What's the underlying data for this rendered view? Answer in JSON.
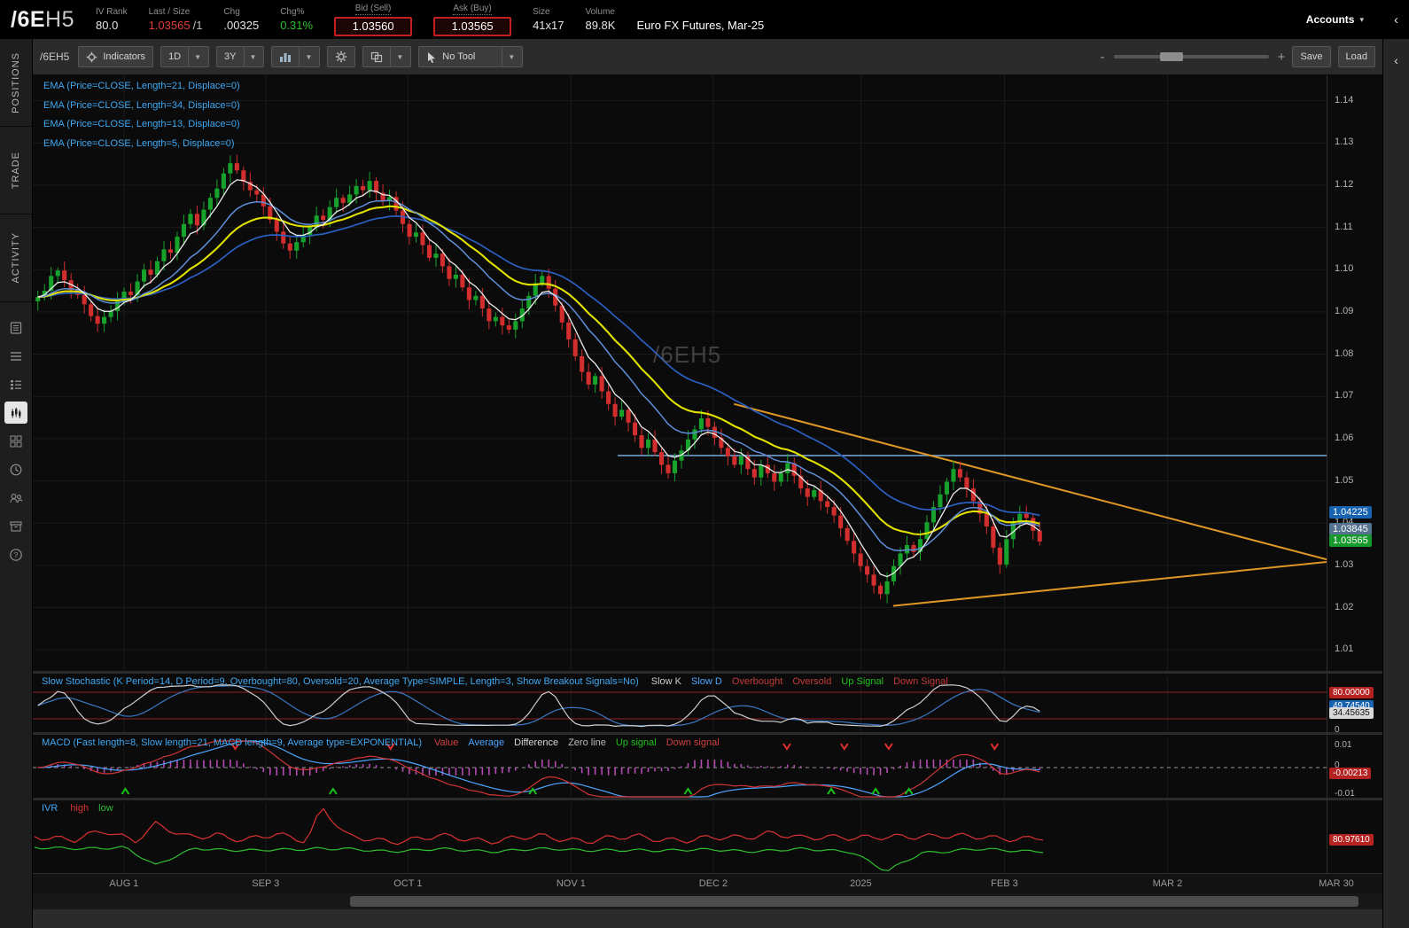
{
  "header": {
    "symbol_root": "/6E",
    "symbol_month": "H5",
    "ivrank_label": "IV Rank",
    "ivrank_value": "80.0",
    "last_label": "Last / Size",
    "last_value": "1.03565",
    "last_size": "/1",
    "chg_label": "Chg",
    "chg_value": ".00325",
    "chgpct_label": "Chg%",
    "chgpct_value": "0.31%",
    "bid_label": "Bid (Sell)",
    "bid_value": "1.03560",
    "ask_label": "Ask (Buy)",
    "ask_value": "1.03565",
    "size_label": "Size",
    "size_value": "41x17",
    "volume_label": "Volume",
    "volume_value": "89.8K",
    "description": "Euro FX Futures, Mar-25",
    "accounts_label": "Accounts",
    "collapse_icon": "‹"
  },
  "sidebar": {
    "tabs": [
      {
        "label": "POSITIONS"
      },
      {
        "label": "TRADE"
      },
      {
        "label": "ACTIVITY"
      }
    ]
  },
  "toolbar": {
    "symbol": "/6EH5",
    "indicators": "Indicators",
    "timeframe": "1D",
    "range": "3Y",
    "no_tool": "No Tool",
    "zoom_minus": "-",
    "zoom_plus": "+",
    "save": "Save",
    "load": "Load",
    "dropdown_arrow": "▼"
  },
  "chart": {
    "ema_labels": [
      "EMA (Price=CLOSE, Length=21, Displace=0)",
      "EMA (Price=CLOSE, Length=34, Displace=0)",
      "EMA (Price=CLOSE, Length=13, Displace=0)",
      "EMA (Price=CLOSE, Length=5, Displace=0)"
    ],
    "watermark": "/6EH5",
    "y_ticks": [
      "1.14",
      "1.13",
      "1.12",
      "1.11",
      "1.10",
      "1.09",
      "1.08",
      "1.07",
      "1.06",
      "1.05",
      "1.04",
      "1.03",
      "1.02",
      "1.01"
    ],
    "x_ticks": [
      {
        "label": "AUG 1",
        "frac": 0.0705
      },
      {
        "label": "SEP 3",
        "frac": 0.18
      },
      {
        "label": "OCT 1",
        "frac": 0.29
      },
      {
        "label": "NOV 1",
        "frac": 0.416
      },
      {
        "label": "DEC 2",
        "frac": 0.526
      },
      {
        "label": "2025",
        "frac": 0.64
      },
      {
        "label": "FEB 3",
        "frac": 0.751
      },
      {
        "label": "MAR 2",
        "frac": 0.877
      },
      {
        "label": "MAR 30",
        "frac": 1.0075
      }
    ],
    "price_bubbles": [
      {
        "text": "1.04225",
        "price": 1.04225,
        "bg": "#1863b0",
        "fg": "#ffffff"
      },
      {
        "text": "1.03845",
        "price": 1.03845,
        "bg": "#55738f",
        "fg": "#ffffff"
      },
      {
        "text": "1.03565",
        "price": 1.03565,
        "bg": "#159a2b",
        "fg": "#ffffff"
      }
    ]
  },
  "chart_data": {
    "type": "candlestick",
    "symbol": "/6EH5",
    "ylim": [
      1.005,
      1.146
    ],
    "up_color": "#17a32b",
    "down_color": "#d22e2e",
    "closes": [
      1.0935,
      1.095,
      1.0985,
      1.0998,
      1.0975,
      1.0952,
      1.094,
      1.0918,
      1.089,
      1.0872,
      1.0888,
      1.0902,
      1.0925,
      1.0948,
      1.094,
      1.0972,
      1.1,
      1.0988,
      1.102,
      1.1048,
      1.104,
      1.1078,
      1.1108,
      1.1132,
      1.1105,
      1.1142,
      1.117,
      1.1192,
      1.1228,
      1.1252,
      1.1235,
      1.1208,
      1.1188,
      1.1178,
      1.115,
      1.1118,
      1.109,
      1.1062,
      1.1045,
      1.1065,
      1.1082,
      1.11,
      1.1128,
      1.1118,
      1.1148,
      1.117,
      1.1158,
      1.1178,
      1.1198,
      1.1188,
      1.121,
      1.1182,
      1.1162,
      1.1172,
      1.114,
      1.1108,
      1.1078,
      1.1088,
      1.1058,
      1.1028,
      1.1038,
      1.1008,
      1.0978,
      1.0988,
      1.0958,
      1.0928,
      1.0938,
      1.0908,
      1.0878,
      1.0888,
      1.0868,
      1.0858,
      1.0878,
      1.0908,
      1.0938,
      1.0968,
      1.0985,
      1.0955,
      1.0915,
      1.0875,
      1.0835,
      1.0795,
      1.0758,
      1.0728,
      1.0748,
      1.0712,
      1.0682,
      1.0652,
      1.0668,
      1.0638,
      1.0608,
      1.0578,
      1.0598,
      1.0568,
      1.0538,
      1.0518,
      1.0548,
      1.0572,
      1.0598,
      1.0622,
      1.0648,
      1.0628,
      1.0602,
      1.0578,
      1.0558,
      1.0538,
      1.0558,
      1.0528,
      1.0508,
      1.0538,
      1.0518,
      1.0498,
      1.0518,
      1.0542,
      1.0512,
      1.0482,
      1.0462,
      1.0478,
      1.0452,
      1.0438,
      1.0418,
      1.0388,
      1.0358,
      1.0328,
      1.0298,
      1.0278,
      1.0252,
      1.0232,
      1.0262,
      1.0298,
      1.0328,
      1.0348,
      1.0332,
      1.0362,
      1.0402,
      1.0438,
      1.0468,
      1.0498,
      1.0528,
      1.0508,
      1.0482,
      1.0452,
      1.0422,
      1.0392,
      1.0342,
      1.0302,
      1.0362,
      1.0402,
      1.0422,
      1.0412,
      1.0382,
      1.03565
    ],
    "emas": [
      {
        "period": 34,
        "color": "#2b5fc0",
        "width": 1.7
      },
      {
        "period": 21,
        "color": "#e2e200",
        "width": 2.1
      },
      {
        "period": 13,
        "color": "#5f8fd8",
        "width": 1.5
      },
      {
        "period": 5,
        "color": "#ececec",
        "width": 1.3
      }
    ],
    "trendlines": [
      {
        "x1": 0.542,
        "p1": 1.0682,
        "x2": 1.0,
        "p2": 1.0314,
        "color": "#e09726"
      },
      {
        "x1": 0.665,
        "p1": 1.0204,
        "x2": 1.0,
        "p2": 1.0308,
        "color": "#e09726"
      }
    ],
    "hline": {
      "price": 1.056,
      "x1": 0.452,
      "color": "#6e9ecb"
    }
  },
  "stoch": {
    "title": "Slow Stochastic (K Period=14, D Period=9, Overbought=80, Oversold=20, Average Type=SIMPLE, Length=3, Show Breakout Signals=No)",
    "legend": [
      {
        "text": "Slow K",
        "color": "#cccccc"
      },
      {
        "text": "Slow D",
        "color": "#4da6ff"
      },
      {
        "text": "Overbought",
        "color": "#c23b3b"
      },
      {
        "text": "Oversold",
        "color": "#c23b3b"
      },
      {
        "text": "Up Signal",
        "color": "#1fc21f"
      },
      {
        "text": "Down Signal",
        "color": "#c23b3b"
      }
    ],
    "overbought": 80,
    "oversold": 20,
    "bubbles": [
      {
        "text": "80.00000",
        "v": 80,
        "bg": "#b42222",
        "fg": "#ffffff"
      },
      {
        "text": "49.74540",
        "v": 49.7454,
        "bg": "#1863b0",
        "fg": "#ffffff"
      },
      {
        "text": "34.45635",
        "v": 34.45635,
        "bg": "#d8d8d8",
        "fg": "#111111"
      }
    ],
    "zero_label": "0"
  },
  "macd": {
    "title": "MACD (Fast length=8, Slow length=21, MACD length=9, Average type=EXPONENTIAL)",
    "legend": [
      {
        "text": "Value",
        "color": "#d04040"
      },
      {
        "text": "Average",
        "color": "#4da6ff"
      },
      {
        "text": "Difference",
        "color": "#d8d8d8"
      },
      {
        "text": "Zero line",
        "color": "#bbbbbb"
      },
      {
        "text": "Up signal",
        "color": "#1fc21f"
      },
      {
        "text": "Down signal",
        "color": "#d04040"
      }
    ],
    "y_top_label": "0.01",
    "y_zero_label": "0",
    "y_bottom_label": "-0.01",
    "bubble": {
      "text": "-0.00213",
      "bg": "#b42222",
      "fg": "#ffffff"
    },
    "up_arrow_fracs": [
      0.09,
      0.296,
      0.494,
      0.648,
      0.79,
      0.834,
      0.867
    ],
    "down_arrow_fracs": [
      0.199,
      0.353,
      0.746,
      0.803,
      0.847,
      0.952
    ]
  },
  "ivr": {
    "title": "IVR",
    "legend": [
      {
        "text": "high",
        "color": "#d83232"
      },
      {
        "text": "low",
        "color": "#2fbf2f"
      }
    ],
    "bubble": {
      "text": "80.97610",
      "bg": "#b42222",
      "fg": "#ffffff"
    },
    "high_anchors": [
      [
        0,
        0.44
      ],
      [
        0.04,
        0.52
      ],
      [
        0.07,
        0.38
      ],
      [
        0.1,
        0.5
      ],
      [
        0.12,
        0.3
      ],
      [
        0.15,
        0.48
      ],
      [
        0.18,
        0.42
      ],
      [
        0.21,
        0.52
      ],
      [
        0.24,
        0.44
      ],
      [
        0.27,
        0.5
      ],
      [
        0.285,
        0.05
      ],
      [
        0.31,
        0.48
      ],
      [
        0.35,
        0.52
      ],
      [
        0.4,
        0.47
      ],
      [
        0.45,
        0.51
      ],
      [
        0.5,
        0.47
      ],
      [
        0.55,
        0.51
      ],
      [
        0.6,
        0.47
      ],
      [
        0.65,
        0.51
      ],
      [
        0.7,
        0.47
      ],
      [
        0.73,
        0.4
      ],
      [
        0.76,
        0.5
      ],
      [
        0.8,
        0.45
      ],
      [
        0.85,
        0.49
      ],
      [
        0.9,
        0.43
      ],
      [
        0.95,
        0.5
      ],
      [
        1,
        0.46
      ]
    ],
    "low_anchors": [
      [
        0,
        0.6
      ],
      [
        0.05,
        0.64
      ],
      [
        0.09,
        0.6
      ],
      [
        0.12,
        0.86
      ],
      [
        0.16,
        0.62
      ],
      [
        0.22,
        0.66
      ],
      [
        0.28,
        0.62
      ],
      [
        0.34,
        0.66
      ],
      [
        0.4,
        0.64
      ],
      [
        0.46,
        0.66
      ],
      [
        0.52,
        0.63
      ],
      [
        0.58,
        0.66
      ],
      [
        0.64,
        0.64
      ],
      [
        0.7,
        0.66
      ],
      [
        0.76,
        0.64
      ],
      [
        0.81,
        0.66
      ],
      [
        0.845,
        0.95
      ],
      [
        0.88,
        0.68
      ],
      [
        0.93,
        0.64
      ],
      [
        1,
        0.66
      ]
    ]
  }
}
